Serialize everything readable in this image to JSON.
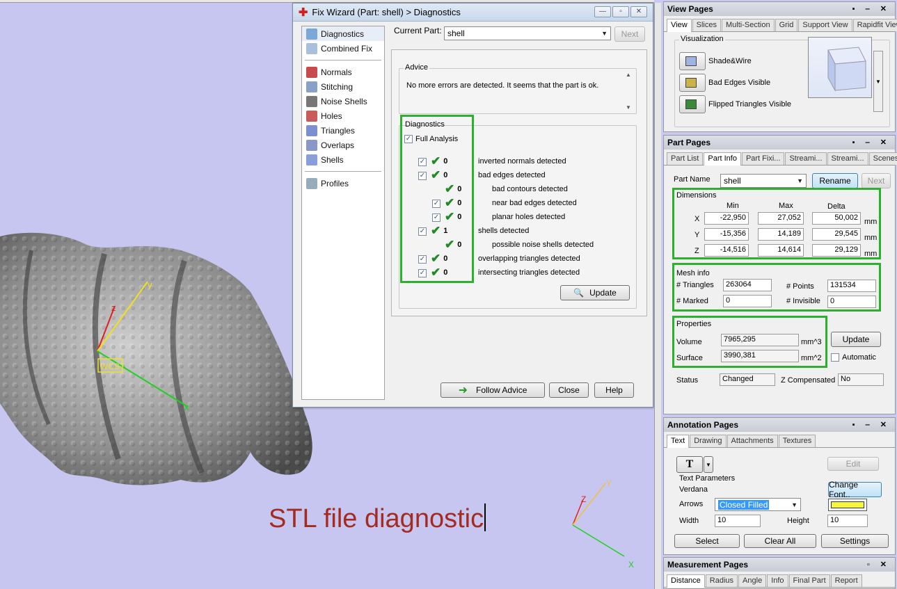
{
  "viewport": {
    "caption": "STL file diagnostic",
    "wcs_label": "WCS",
    "axis_labels": {
      "x": "x",
      "y": "y",
      "z": "z"
    },
    "mini_axis_labels": {
      "x": "X",
      "y": "Y",
      "z": "Z"
    }
  },
  "dialog": {
    "title": "Fix Wizard (Part: shell) > Diagnostics",
    "nav_top": [
      {
        "label": "Diagnostics",
        "icon": "magnifier-icon",
        "selected": true
      },
      {
        "label": "Combined Fix",
        "icon": "combined-fix-icon"
      }
    ],
    "nav_tools": [
      {
        "label": "Normals",
        "icon": "normals-icon"
      },
      {
        "label": "Stitching",
        "icon": "stitching-icon"
      },
      {
        "label": "Noise Shells",
        "icon": "noise-shells-icon"
      },
      {
        "label": "Holes",
        "icon": "holes-icon"
      },
      {
        "label": "Triangles",
        "icon": "triangles-icon"
      },
      {
        "label": "Overlaps",
        "icon": "overlaps-icon"
      },
      {
        "label": "Shells",
        "icon": "shells-icon"
      }
    ],
    "nav_bottom": [
      {
        "label": "Profiles",
        "icon": "profiles-icon"
      }
    ],
    "current_part_label": "Current Part:",
    "current_part_value": "shell",
    "next_label": "Next",
    "advice_title": "Advice",
    "advice_text": "No more errors are detected. It seems that the part is ok.",
    "diagnostics_title": "Diagnostics",
    "full_analysis_label": "Full Analysis",
    "rows": [
      {
        "checkbox": true,
        "count": "0",
        "label": "inverted normals detected",
        "indent": 0
      },
      {
        "checkbox": true,
        "count": "0",
        "label": "bad edges detected",
        "indent": 0
      },
      {
        "checkbox": false,
        "count": "0",
        "label": "bad contours detected",
        "indent": 1
      },
      {
        "checkbox": true,
        "count": "0",
        "label": "near bad edges detected",
        "indent": 1
      },
      {
        "checkbox": true,
        "count": "0",
        "label": "planar holes detected",
        "indent": 1
      },
      {
        "checkbox": true,
        "count": "1",
        "label": "shells detected",
        "indent": 0
      },
      {
        "checkbox": false,
        "count": "0",
        "label": "possible noise shells detected",
        "indent": 1
      },
      {
        "checkbox": true,
        "count": "0",
        "label": "overlapping triangles detected",
        "indent": 0
      },
      {
        "checkbox": true,
        "count": "0",
        "label": "intersecting triangles detected",
        "indent": 0
      }
    ],
    "update_label": "Update",
    "follow_advice_label": "Follow Advice",
    "close_label": "Close",
    "help_label": "Help"
  },
  "view_pages": {
    "title": "View Pages",
    "tabs": [
      "View",
      "Slices",
      "Multi-Section",
      "Grid",
      "Support View",
      "Rapidfit View"
    ],
    "visualization_title": "Visualization",
    "items": [
      {
        "label": "Shade&Wire",
        "icon": "shade-wire-icon"
      },
      {
        "label": "Bad Edges Visible",
        "icon": "bad-edges-icon"
      },
      {
        "label": "Flipped Triangles Visible",
        "icon": "flipped-triangles-icon"
      }
    ]
  },
  "part_pages": {
    "title": "Part Pages",
    "tabs": [
      "Part List",
      "Part Info",
      "Part Fixi...",
      "Streami...",
      "Streami...",
      "Scenes"
    ],
    "part_name_label": "Part Name",
    "part_name_value": "shell",
    "rename_label": "Rename",
    "next_label": "Next",
    "dimensions_title": "Dimensions",
    "dim_headers": [
      "Min",
      "Max",
      "Delta"
    ],
    "dim_rows": [
      {
        "axis": "X",
        "min": "-22,950",
        "max": "27,052",
        "delta": "50,002",
        "unit": "mm"
      },
      {
        "axis": "Y",
        "min": "-15,356",
        "max": "14,189",
        "delta": "29,545",
        "unit": "mm"
      },
      {
        "axis": "Z",
        "min": "-14,516",
        "max": "14,614",
        "delta": "29,129",
        "unit": "mm"
      }
    ],
    "mesh_title": "Mesh info",
    "triangles_label": "# Triangles",
    "triangles_value": "263064",
    "points_label": "# Points",
    "points_value": "131534",
    "marked_label": "# Marked",
    "marked_value": "0",
    "invisible_label": "# Invisible",
    "invisible_value": "0",
    "properties_title": "Properties",
    "volume_label": "Volume",
    "volume_value": "7965,295",
    "volume_unit": "mm^3",
    "surface_label": "Surface",
    "surface_value": "3990,381",
    "surface_unit": "mm^2",
    "update_label": "Update",
    "automatic_label": "Automatic",
    "status_label": "Status",
    "status_value": "Changed",
    "zcomp_label": "Z Compensated",
    "zcomp_value": "No"
  },
  "annotation_pages": {
    "title": "Annotation Pages",
    "tabs": [
      "Text",
      "Drawing",
      "Attachments",
      "Textures"
    ],
    "text_tool_glyph": "T",
    "edit_label": "Edit",
    "params_title": "Text Parameters",
    "font_value": "Verdana",
    "change_font_label": "Change Font..",
    "arrows_label": "Arrows",
    "arrows_value": "Closed Filled",
    "arrow_color": "#f5f542",
    "width_label": "Width",
    "width_value": "10",
    "height_label": "Height",
    "height_value": "10",
    "select_label": "Select",
    "clear_all_label": "Clear All",
    "settings_label": "Settings"
  },
  "measurement_pages": {
    "title": "Measurement Pages",
    "tabs": [
      "Distance",
      "Radius",
      "Angle",
      "Info",
      "Final Part",
      "Report"
    ]
  }
}
